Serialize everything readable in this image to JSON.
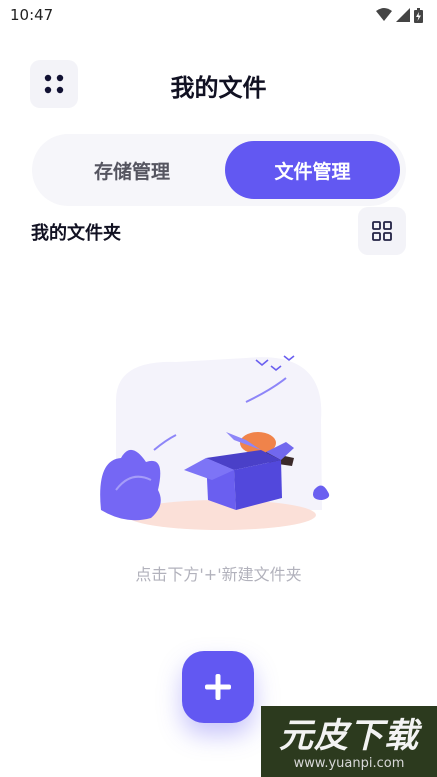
{
  "status_bar": {
    "time": "10:47",
    "icons": [
      "wifi-icon",
      "signal-icon",
      "battery-icon"
    ]
  },
  "header": {
    "title": "我的文件",
    "menu_icon": "four-dots-icon"
  },
  "tabs": [
    {
      "label": "存储管理",
      "active": false
    },
    {
      "label": "文件管理",
      "active": true
    }
  ],
  "section": {
    "title": "我的文件夹",
    "view_icon": "grid-view-icon"
  },
  "empty_state": {
    "illustration": "open-box-illustration",
    "hint": "点击下方'+'新建文件夹"
  },
  "fab": {
    "icon": "plus-icon"
  },
  "watermark": {
    "brand": "元皮下载",
    "url": "www.yuanpi.com"
  },
  "colors": {
    "accent": "#6258f2",
    "tab_bg": "#f6f6fa",
    "button_bg": "#f3f3f8",
    "hint": "#b2b2bc"
  }
}
